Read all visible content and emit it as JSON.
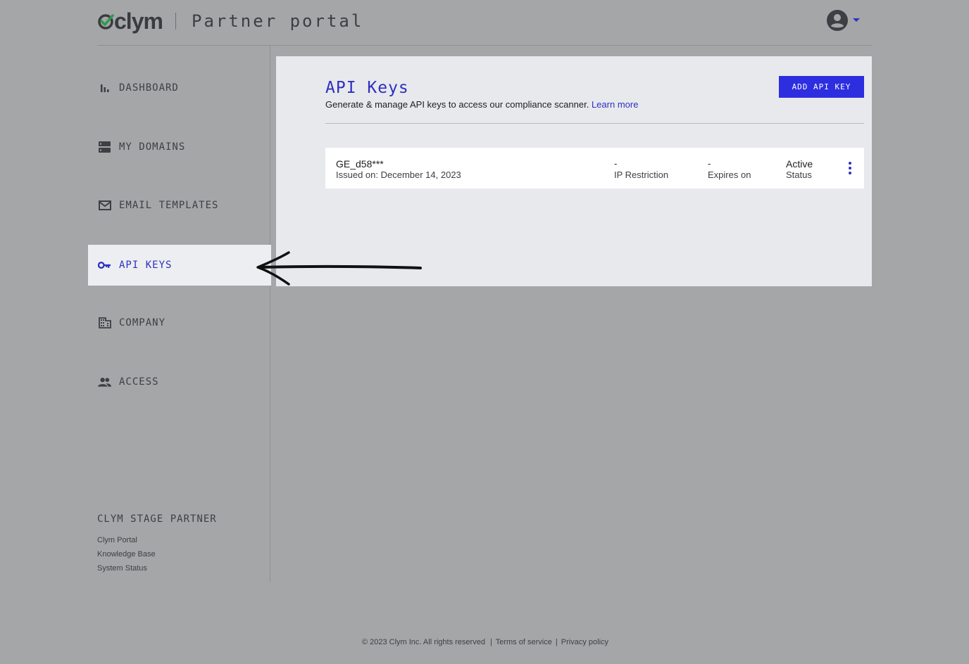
{
  "header": {
    "logo_text": "clym",
    "portal_title": "Partner portal",
    "avatar_icon": "account-circle-icon"
  },
  "sidebar": {
    "items": [
      {
        "label": "DASHBOARD",
        "icon": "bar-chart-icon",
        "active": false
      },
      {
        "label": "MY DOMAINS",
        "icon": "server-icon",
        "active": false
      },
      {
        "label": "EMAIL TEMPLATES",
        "icon": "mail-icon",
        "active": false
      },
      {
        "label": "API KEYS",
        "icon": "key-icon",
        "active": true
      },
      {
        "label": "COMPANY",
        "icon": "building-icon",
        "active": false
      },
      {
        "label": "ACCESS",
        "icon": "people-icon",
        "active": false
      }
    ],
    "org_name": "CLYM STAGE PARTNER",
    "links": [
      "Clym Portal",
      "Knowledge Base",
      "System Status"
    ]
  },
  "main": {
    "title": "API Keys",
    "subtitle": "Generate & manage API keys to access our compliance scanner.",
    "learn_more": "Learn more",
    "add_button": "ADD API KEY",
    "keys": [
      {
        "name": "GE_d58***",
        "issued": "Issued on: December 14, 2023",
        "ip_restriction_value": "-",
        "ip_restriction_label": "IP Restriction",
        "expires_value": "-",
        "expires_label": "Expires on",
        "status_value": "Active",
        "status_label": "Status"
      }
    ]
  },
  "footer": {
    "copyright": "© 2023 Clym Inc. All rights reserved",
    "separator": "|",
    "terms": "Terms of service",
    "privacy": "Privacy policy"
  },
  "colors": {
    "accent": "#2f2fbf",
    "button": "#2d2ee0",
    "background": "#a5a6a8",
    "panel": "#e8e9ed"
  }
}
